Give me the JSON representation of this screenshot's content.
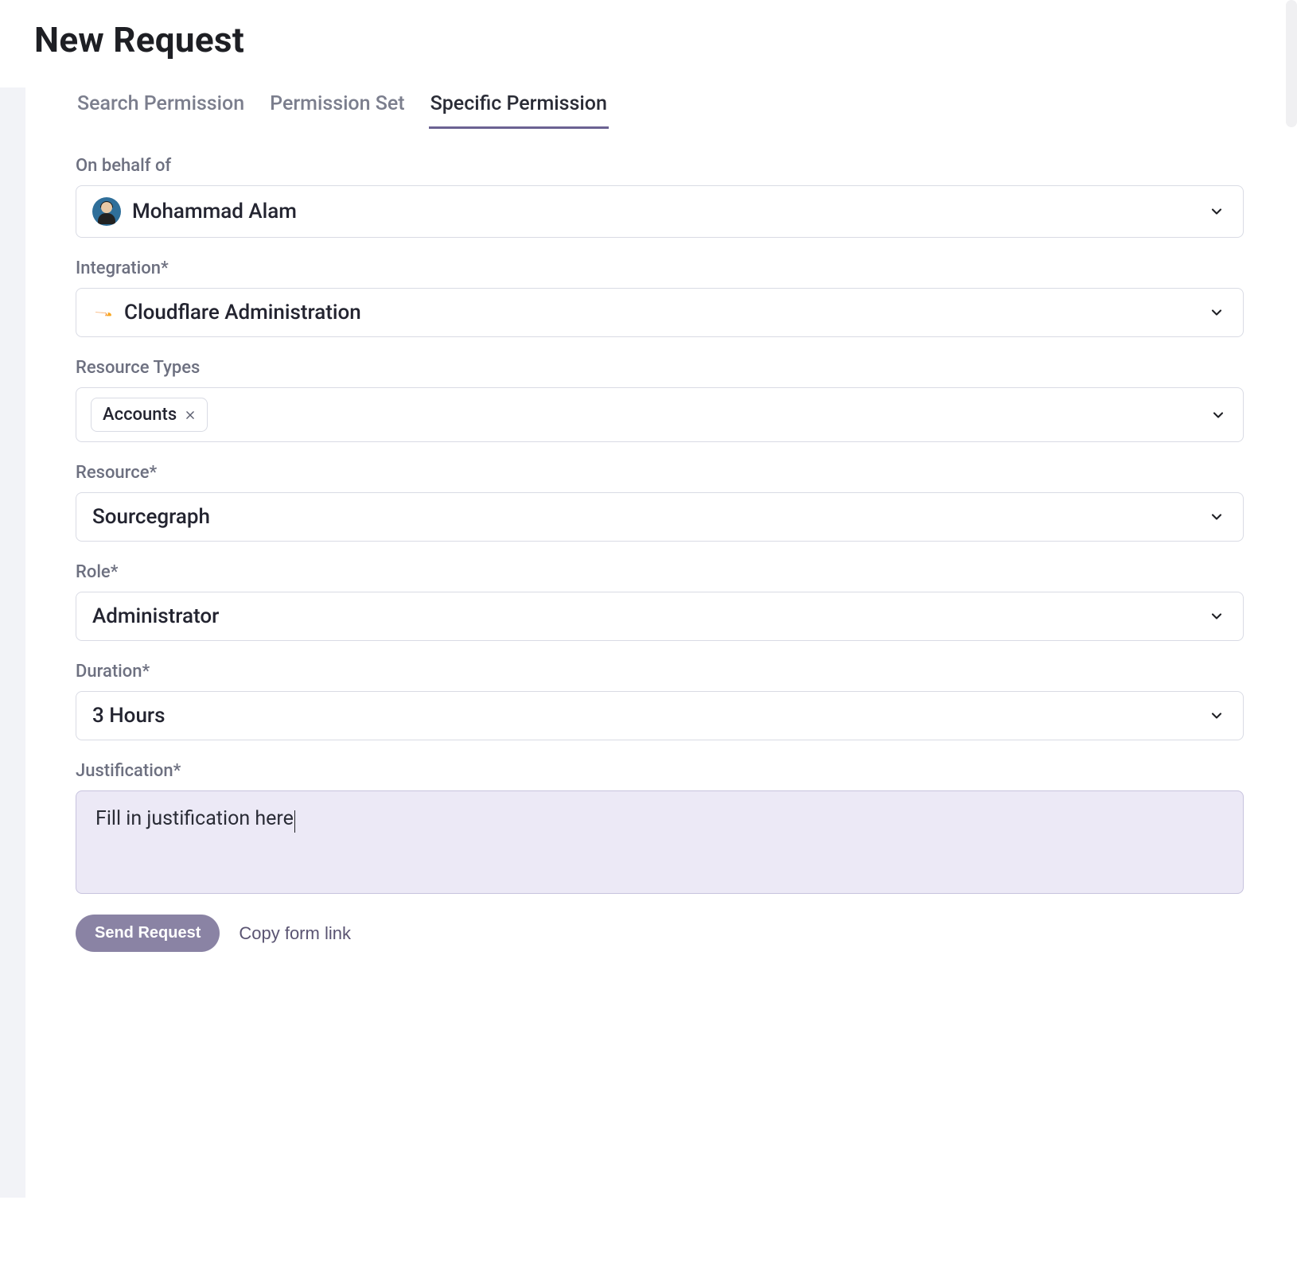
{
  "page": {
    "title": "New Request"
  },
  "tabs": [
    {
      "label": "Search Permission",
      "active": false
    },
    {
      "label": "Permission Set",
      "active": false
    },
    {
      "label": "Specific Permission",
      "active": true
    }
  ],
  "form": {
    "onBehalf": {
      "label": "On behalf of",
      "value": "Mohammad Alam"
    },
    "integration": {
      "label": "Integration*",
      "value": "Cloudflare Administration"
    },
    "resourceTypes": {
      "label": "Resource Types",
      "chips": [
        {
          "label": "Accounts"
        }
      ]
    },
    "resource": {
      "label": "Resource*",
      "value": "Sourcegraph"
    },
    "role": {
      "label": "Role*",
      "value": "Administrator"
    },
    "duration": {
      "label": "Duration*",
      "value": "3 Hours"
    },
    "justification": {
      "label": "Justification*",
      "value": "Fill in justification here"
    }
  },
  "actions": {
    "submit": "Send Request",
    "copyLink": "Copy form link"
  }
}
